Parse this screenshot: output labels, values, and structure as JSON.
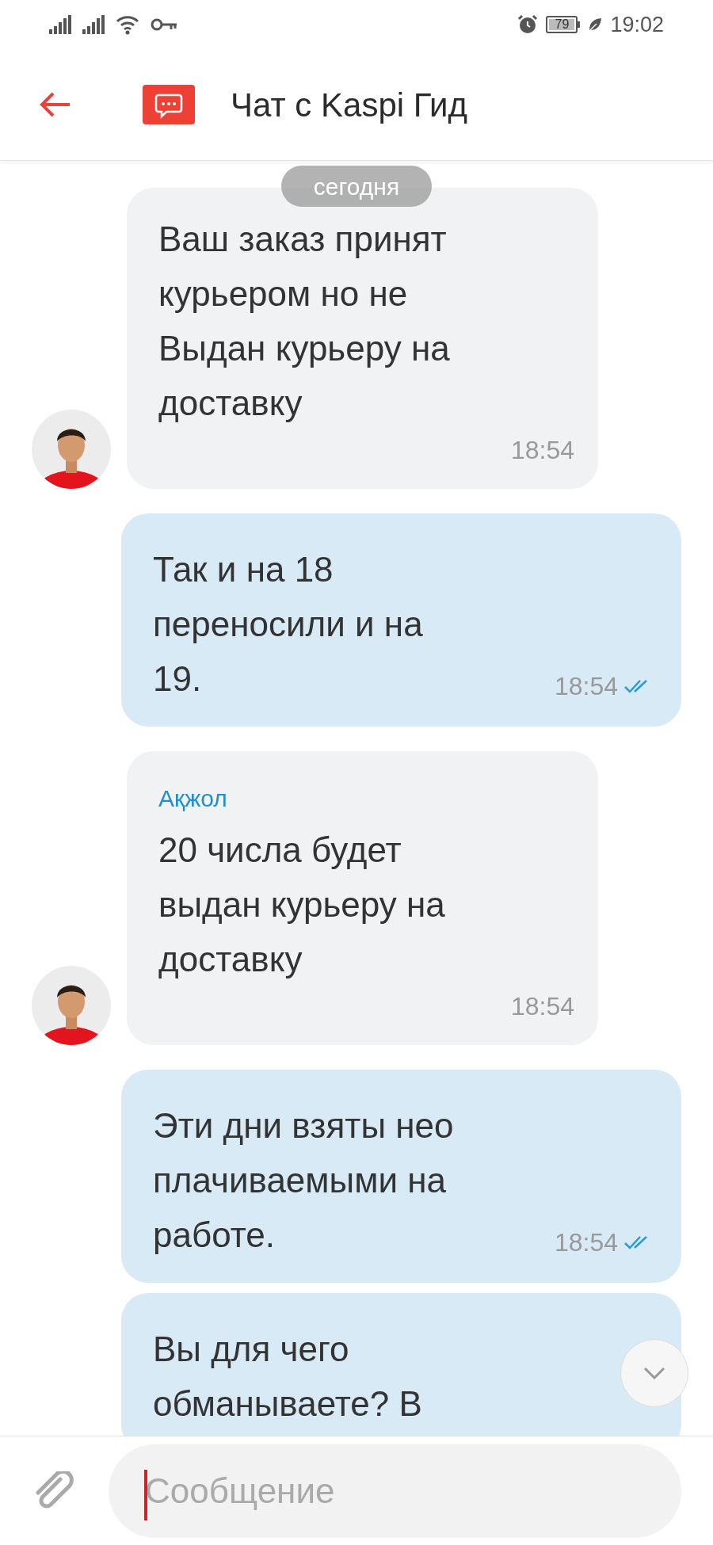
{
  "status_bar": {
    "battery": "79",
    "time": "19:02"
  },
  "header": {
    "title": "Чат с Kaspi Гид"
  },
  "date_chip": "сегодня",
  "messages": [
    {
      "kind": "incoming",
      "text": "Ваш заказ принят курьером но не Выдан курьеру на доставку",
      "time": "18:54"
    },
    {
      "kind": "outgoing",
      "text": "Так и на 18 переносили и на 19.",
      "time": "18:54",
      "read": true
    },
    {
      "kind": "incoming",
      "sender": "Ақжол",
      "text": "20 числа будет выдан курьеру на доставку",
      "time": "18:54"
    },
    {
      "kind": "outgoing",
      "text": "Эти дни взяты нео плачиваемыми на работе.",
      "time": "18:54",
      "read": true
    },
    {
      "kind": "outgoing",
      "text": "Вы для чего обманываете? В"
    }
  ],
  "composer": {
    "placeholder": "Сообщение"
  }
}
